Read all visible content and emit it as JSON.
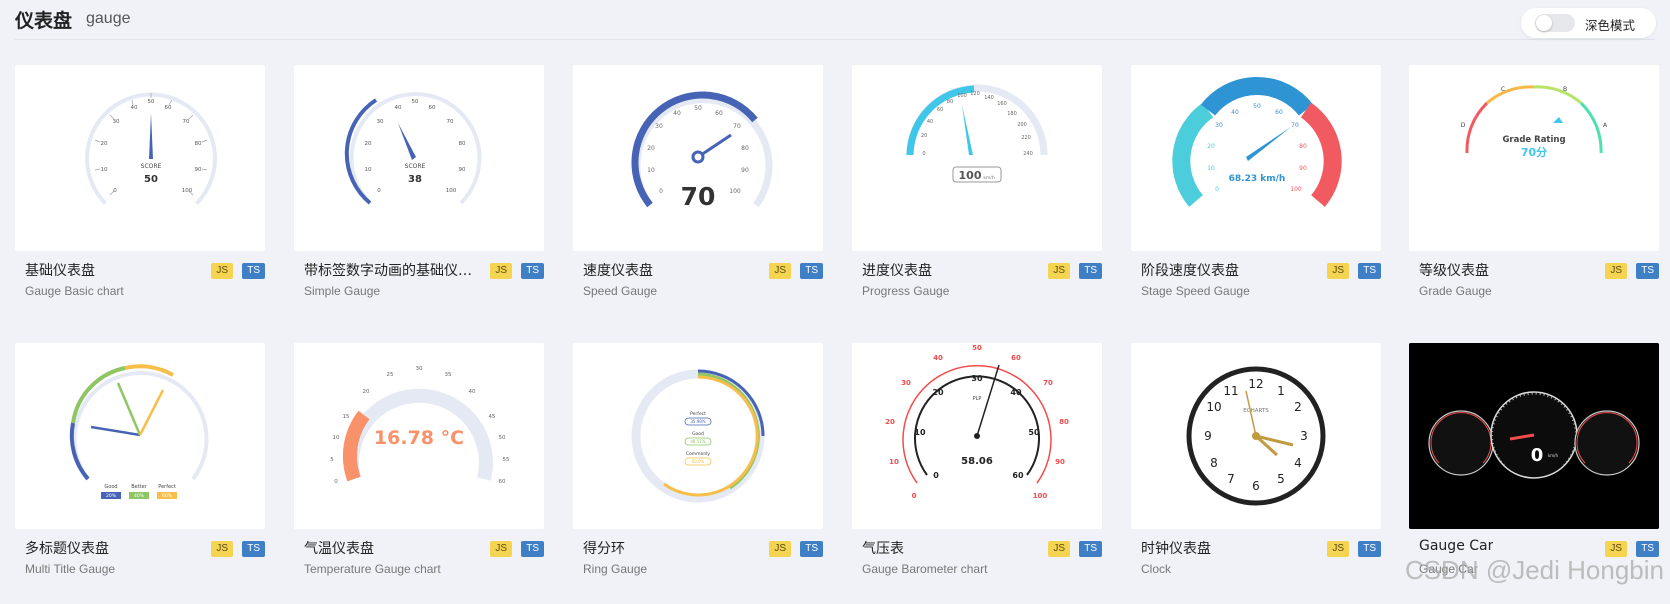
{
  "header": {
    "title": "仪表盘",
    "subtitle": "gauge"
  },
  "dark_mode": {
    "label": "深色模式",
    "enabled": false
  },
  "badges": {
    "js": "JS",
    "ts": "TS"
  },
  "cards": [
    {
      "title": "基础仪表盘",
      "subtitle": "Gauge Basic chart",
      "preview": {
        "label": "SCORE",
        "value": "50",
        "ticks": [
          "0",
          "10",
          "20",
          "30",
          "40",
          "50",
          "60",
          "70",
          "80",
          "90",
          "100"
        ]
      }
    },
    {
      "title": "带标签数字动画的基础仪表盘",
      "subtitle": "Simple Gauge",
      "preview": {
        "label": "SCORE",
        "value": "38",
        "ticks": [
          "0",
          "10",
          "20",
          "30",
          "40",
          "50",
          "60",
          "70",
          "80",
          "90",
          "100"
        ]
      }
    },
    {
      "title": "速度仪表盘",
      "subtitle": "Speed Gauge",
      "preview": {
        "value": "70",
        "ticks": [
          "0",
          "10",
          "20",
          "30",
          "40",
          "50",
          "60",
          "70",
          "80",
          "90",
          "100"
        ]
      }
    },
    {
      "title": "进度仪表盘",
      "subtitle": "Progress Gauge",
      "preview": {
        "value": "100",
        "unit": "km/h",
        "ticks": [
          "0",
          "20",
          "40",
          "60",
          "80",
          "100",
          "120",
          "140",
          "160",
          "180",
          "200",
          "220",
          "240"
        ]
      }
    },
    {
      "title": "阶段速度仪表盘",
      "subtitle": "Stage Speed Gauge",
      "preview": {
        "value": "68.23 km/h",
        "ticks": [
          "0",
          "10",
          "20",
          "30",
          "40",
          "50",
          "60",
          "70",
          "80",
          "90",
          "100"
        ]
      }
    },
    {
      "title": "等级仪表盘",
      "subtitle": "Grade Gauge",
      "preview": {
        "label": "Grade Rating",
        "value": "70分",
        "grades": [
          "D",
          "C",
          "B",
          "A"
        ]
      }
    },
    {
      "title": "多标题仪表盘",
      "subtitle": "Multi Title Gauge",
      "preview": {
        "labels": [
          "Good",
          "Better",
          "Perfect"
        ],
        "values": [
          "20%",
          "40%",
          "60%"
        ]
      }
    },
    {
      "title": "气温仪表盘",
      "subtitle": "Temperature Gauge chart",
      "preview": {
        "value": "16.78 °C",
        "ticks": [
          "0",
          "5",
          "10",
          "15",
          "20",
          "25",
          "30",
          "35",
          "40",
          "45",
          "50",
          "55",
          "60"
        ]
      }
    },
    {
      "title": "得分环",
      "subtitle": "Ring Gauge",
      "preview": {
        "labels": [
          "Perfect",
          "Good",
          "Commonly"
        ],
        "values": [
          "35.99%",
          "48.51%",
          "60.0%"
        ]
      }
    },
    {
      "title": "气压表",
      "subtitle": "Gauge Barometer chart",
      "preview": {
        "label": "PLP",
        "value": "58.06",
        "inner_ticks": [
          "0",
          "10",
          "20",
          "30",
          "40",
          "50",
          "60"
        ],
        "outer_ticks": [
          "0",
          "10",
          "20",
          "30",
          "40",
          "50",
          "60",
          "70",
          "80",
          "90",
          "100"
        ]
      }
    },
    {
      "title": "时钟仪表盘",
      "subtitle": "Clock",
      "preview": {
        "brand": "ECHARTS",
        "numbers": [
          "12",
          "1",
          "2",
          "3",
          "4",
          "5",
          "6",
          "7",
          "8",
          "9",
          "10",
          "11"
        ]
      }
    },
    {
      "title": "Gauge Car",
      "subtitle": "Gauge Car",
      "preview": {
        "speed": "0",
        "speed_unit": "km/h"
      }
    }
  ],
  "watermark": "CSDN @Jedi Hongbin",
  "colors": {
    "blue": "#4763b5",
    "cyan": "#3fc6e8",
    "red": "#f24c4c",
    "orange": "#f9916b",
    "green": "#8ec663",
    "yellow": "#f7be4a",
    "page_bg": "#f1f2f8"
  }
}
